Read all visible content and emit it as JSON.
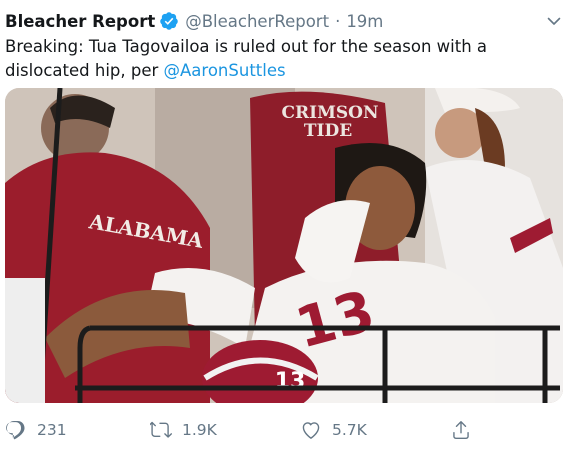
{
  "tweet": {
    "display_name": "Bleacher Report",
    "handle": "@BleacherReport",
    "separator": "·",
    "time": "19m",
    "text_before": "Breaking: Tua Tagovailoa is ruled out for the season with a dislocated hip, per ",
    "mention": "@AaronSuttles",
    "verified_badge_icon": "verified-badge-icon",
    "menu_icon": "chevron-down-icon"
  },
  "media": {
    "jersey_text": "ALABAMA",
    "shirt_text_line1": "CRIMSON",
    "shirt_text_line2": "TIDE",
    "helmet_number": "13"
  },
  "actions": {
    "reply": {
      "icon": "reply-icon",
      "count": "231"
    },
    "retweet": {
      "icon": "retweet-icon",
      "count": "1.9K"
    },
    "like": {
      "icon": "heart-icon",
      "count": "5.7K"
    },
    "share": {
      "icon": "share-icon"
    }
  },
  "colors": {
    "link": "#1b95e0",
    "verified": "#1da1f2",
    "secondary_text": "#657786",
    "crimson": "#9e1b32"
  }
}
